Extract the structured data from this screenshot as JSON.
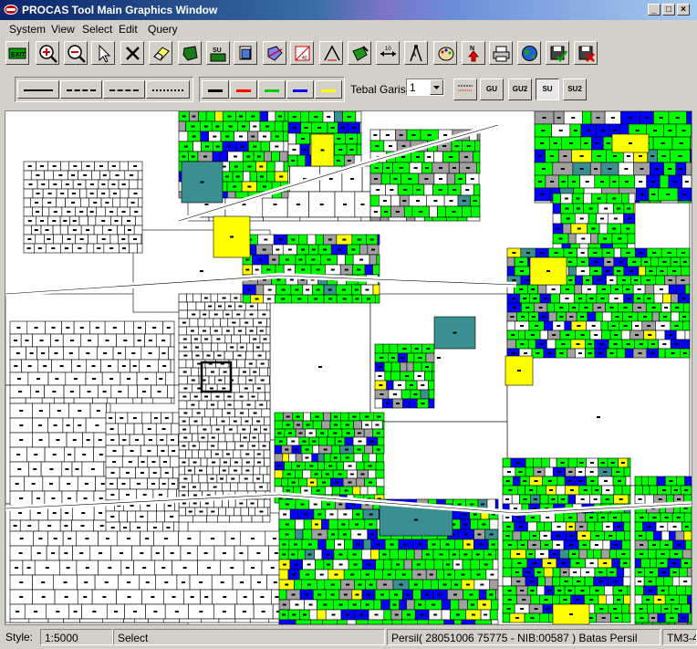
{
  "window": {
    "title": "PROCAS Tool Main Graphics Window"
  },
  "menu": [
    "System",
    "View",
    "Select",
    "Edit",
    "Query"
  ],
  "toolbar": {
    "buttons": [
      {
        "name": "exit-button",
        "icon": "exit-icon"
      },
      {
        "name": "zoom-in-button",
        "icon": "zoom-in-icon"
      },
      {
        "name": "zoom-out-button",
        "icon": "zoom-out-icon"
      },
      {
        "name": "select-pointer-button",
        "icon": "pointer-icon"
      },
      {
        "name": "delete-button",
        "icon": "delete-icon"
      },
      {
        "name": "eraser-button",
        "icon": "eraser-icon"
      },
      {
        "name": "polygon-button",
        "icon": "polygon-icon"
      },
      {
        "name": "su-button",
        "icon": "su-icon"
      },
      {
        "name": "layers-button",
        "icon": "layers-icon"
      },
      {
        "name": "merge-button",
        "icon": "merge-icon"
      },
      {
        "name": "grid-button",
        "icon": "grid-icon"
      },
      {
        "name": "angle-button",
        "icon": "angle-icon"
      },
      {
        "name": "edit-parcel-button",
        "icon": "edit-parcel-icon"
      },
      {
        "name": "measure-button",
        "icon": "measure-icon"
      },
      {
        "name": "compass-button",
        "icon": "compass-icon"
      },
      {
        "name": "palette-button",
        "icon": "palette-icon"
      },
      {
        "name": "north-arrow-button",
        "icon": "north-arrow-icon"
      },
      {
        "name": "print-button",
        "icon": "print-icon"
      },
      {
        "name": "globe-button",
        "icon": "globe-icon"
      },
      {
        "name": "save-check-button",
        "icon": "save-check-icon"
      },
      {
        "name": "save-cancel-button",
        "icon": "save-cancel-icon"
      }
    ]
  },
  "line_styles": [
    "solid",
    "dashed",
    "dash-dot",
    "dotted"
  ],
  "colors": {
    "black": "#000000",
    "red": "#ff0000",
    "green": "#00cc00",
    "blue": "#0000ff",
    "yellow": "#ffff00"
  },
  "line_width": {
    "label": "Tebal Garis",
    "value": "1"
  },
  "su_buttons": [
    "GU",
    "GU2",
    "SU",
    "SU2"
  ],
  "status": {
    "style_label": "Style:",
    "scale": "1:5000",
    "mode": "Select",
    "info": "Persil( 28051006 75775 - NIB:00587 ) Batas Persil",
    "sheet": "TM3-4"
  },
  "map_colors": {
    "green": "#00ff00",
    "blue": "#0000ff",
    "yellow": "#ffff00",
    "gray": "#a0a0a0",
    "teal": "#3a9090",
    "white": "#ffffff"
  }
}
